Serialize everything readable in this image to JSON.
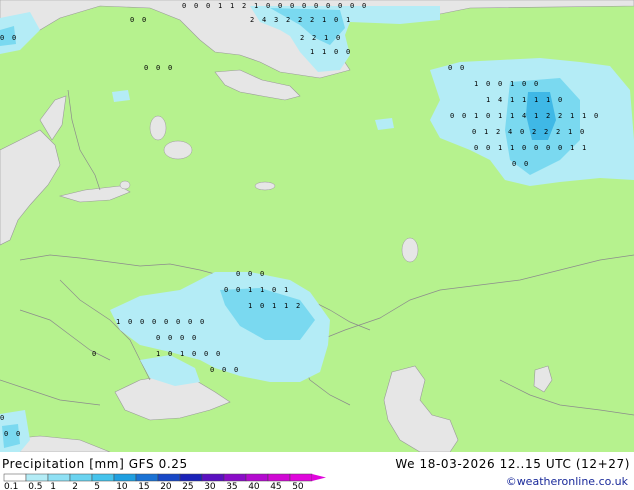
{
  "map": {
    "colors": {
      "land": "#b6f28e",
      "sea": "#e6e6e6",
      "border": "#8c8c8c",
      "precip_light": "#b4ecf6",
      "precip_mid": "#7ad9f0",
      "precip_heavy": "#3fb8e6"
    },
    "precip_clusters": [
      {
        "name": "barents",
        "labels": [
          "0",
          "0",
          "0",
          "1",
          "1",
          "2",
          "1",
          "0",
          "0",
          "0",
          "0",
          "0",
          "0",
          "0",
          "0",
          "0",
          "2",
          "4",
          "3",
          "2",
          "2",
          "2",
          "1",
          "0",
          "1",
          "2",
          "2",
          "1",
          "0",
          "1",
          "1",
          "0",
          "0"
        ]
      },
      {
        "name": "urals",
        "labels": [
          "0",
          "0",
          "1",
          "0",
          "0",
          "1",
          "0",
          "0",
          "1",
          "4",
          "1",
          "1",
          "1",
          "1",
          "0",
          "0",
          "0",
          "1",
          "0",
          "1",
          "1",
          "4",
          "1",
          "2",
          "2",
          "1",
          "1",
          "0",
          "0",
          "1",
          "2",
          "4",
          "0",
          "2",
          "2",
          "2",
          "1",
          "0",
          "0",
          "0",
          "1",
          "1",
          "0",
          "0",
          "0",
          "0",
          "1",
          "1",
          "0",
          "0"
        ]
      },
      {
        "name": "south-russia",
        "labels": [
          "0",
          "0",
          "0",
          "0",
          "0",
          "1",
          "1",
          "0",
          "1",
          "1",
          "0",
          "1",
          "1",
          "2",
          "1",
          "0",
          "0",
          "0",
          "0",
          "0",
          "0",
          "0",
          "0",
          "0",
          "0",
          "0",
          "1",
          "0",
          "1",
          "0",
          "0",
          "0",
          "0",
          "0",
          "0"
        ]
      },
      {
        "name": "west",
        "labels": [
          "0",
          "0",
          "0",
          "0",
          "0",
          "0",
          "0",
          "0",
          "0",
          "0",
          "0"
        ]
      }
    ]
  },
  "footer": {
    "title": "Precipitation [mm]  GFS 0.25",
    "datetime": "We 18-03-2026 12..15 UTC (12+27)",
    "credit": "©weatheronline.co.uk"
  },
  "scale": {
    "labels": [
      "0.1",
      "0.5",
      "1",
      "2",
      "5",
      "10",
      "15",
      "20",
      "25",
      "30",
      "35",
      "40",
      "45",
      "50"
    ],
    "colors": [
      "#ffffff",
      "#b4ecf6",
      "#8fe0f4",
      "#6ad3f0",
      "#45c3ec",
      "#1f9fe0",
      "#1a72d4",
      "#1747c6",
      "#1a22b8",
      "#5a10c0",
      "#8a0cc8",
      "#b40ad0",
      "#d008d4",
      "#e006dc"
    ]
  }
}
